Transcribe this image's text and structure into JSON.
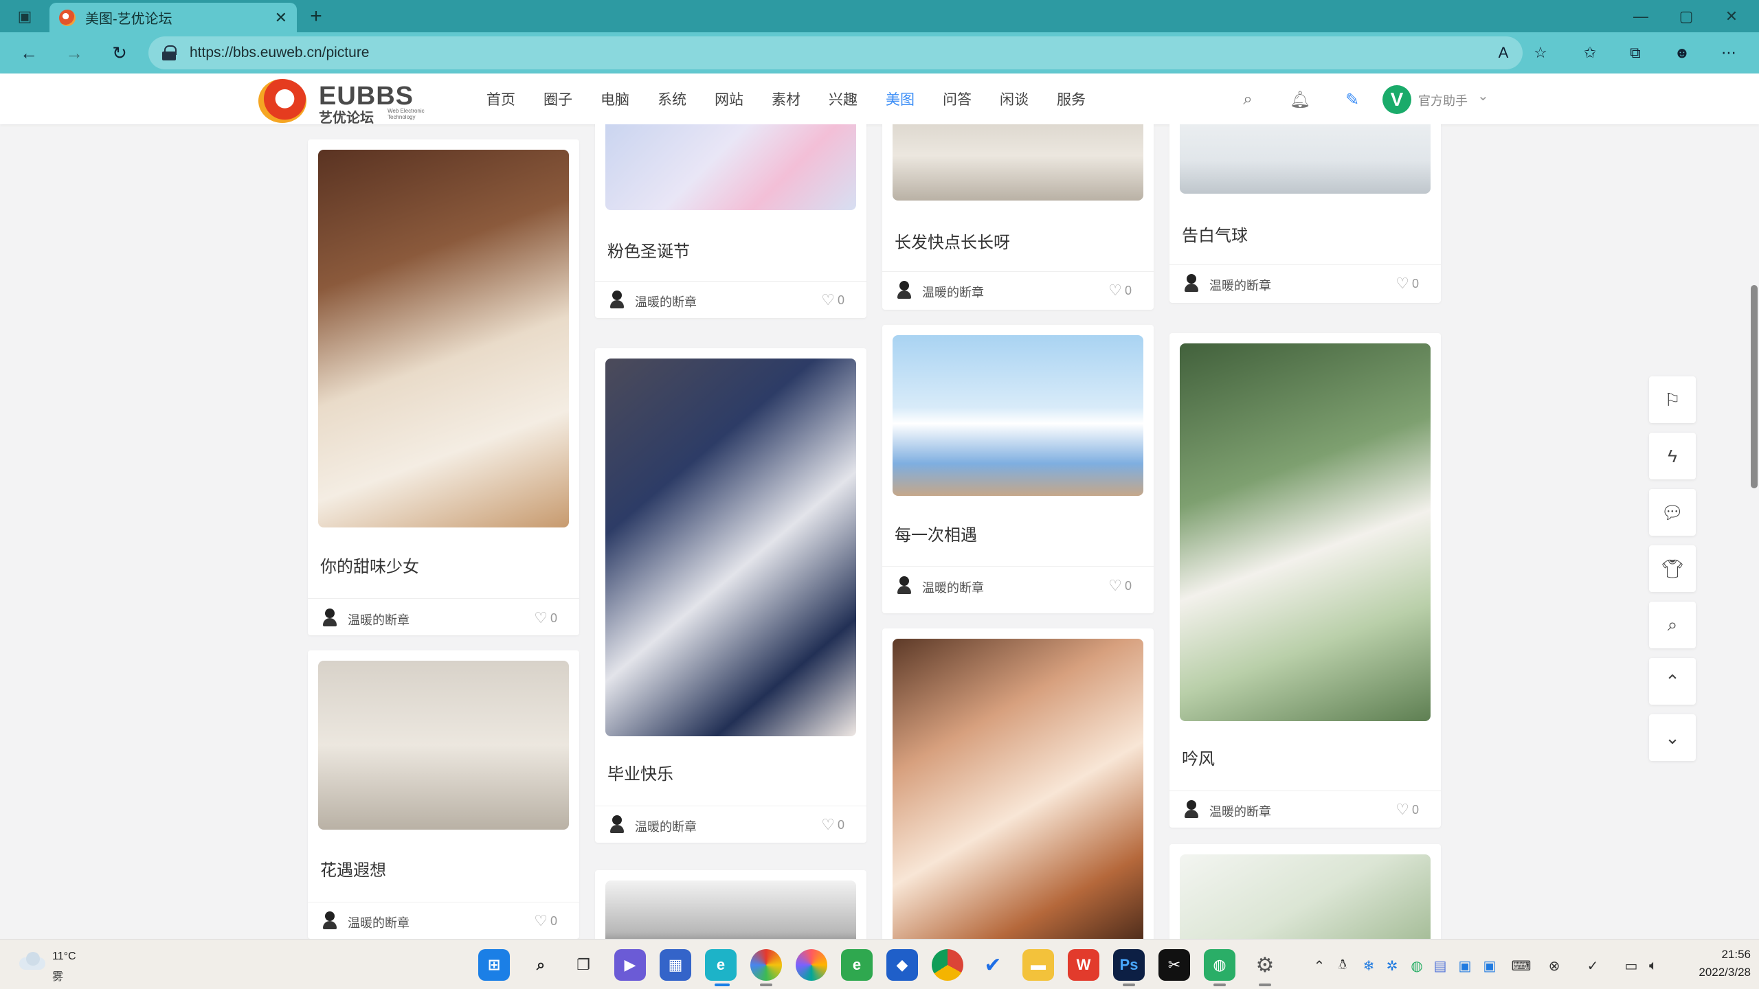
{
  "browser": {
    "tab_title": "美图-艺优论坛",
    "url": "https://bbs.euweb.cn/picture"
  },
  "site": {
    "logo_word": "EUBBS",
    "logo_cn": "艺优论坛",
    "logo_sub": "Web Electronic Technology",
    "menu": [
      "首页",
      "圈子",
      "电脑",
      "系统",
      "网站",
      "素材",
      "兴趣",
      "美图",
      "问答",
      "闲谈",
      "服务"
    ],
    "active_menu": "美图",
    "user_avatar_letter": "V",
    "user_name": "官方助手"
  },
  "posts": [
    {
      "title": "你的甜味少女",
      "author": "温暖的断章",
      "likes": "0"
    },
    {
      "title": "花遇遐想",
      "author": "温暖的断章",
      "likes": "0"
    },
    {
      "title": "粉色圣诞节",
      "author": "温暖的断章",
      "likes": "0"
    },
    {
      "title": "毕业快乐",
      "author": "温暖的断章",
      "likes": "0"
    },
    {
      "title": "长发快点长长呀",
      "author": "温暖的断章",
      "likes": "0"
    },
    {
      "title": "每一次相遇",
      "author": "温暖的断章",
      "likes": "0"
    },
    {
      "title": "告白气球",
      "author": "温暖的断章",
      "likes": "0"
    },
    {
      "title": "吟风",
      "author": "温暖的断章",
      "likes": "0"
    }
  ],
  "taskbar": {
    "weather_temp": "11°C",
    "weather_desc": "雾",
    "time": "21:56",
    "date": "2022/3/28"
  },
  "colors": {
    "tabbar": "#2d9aa2",
    "toolbar": "#61c8cf",
    "accent": "#3b8df6",
    "user_avatar": "#1aab6a"
  }
}
